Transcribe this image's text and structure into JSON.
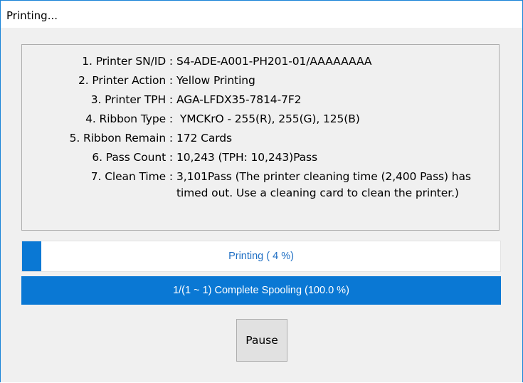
{
  "window": {
    "title": "Printing..."
  },
  "info": {
    "rows": [
      {
        "label": "1. Printer SN/ID :",
        "value": "S4-ADE-A001-PH201-01/AAAAAAAA"
      },
      {
        "label": "2. Printer Action :",
        "value": "Yellow Printing"
      },
      {
        "label": "3. Printer TPH :",
        "value": "AGA-LFDX35-7814-7F2"
      },
      {
        "label": "4. Ribbon Type :",
        "value": " YMCKrO - 255(R), 255(G), 125(B)"
      },
      {
        "label": "5. Ribbon Remain :",
        "value": "172 Cards"
      },
      {
        "label": "6. Pass Count :",
        "value": "10,243 (TPH: 10,243)Pass"
      },
      {
        "label": "7. Clean Time :",
        "value": "3,101Pass (The printer cleaning time (2,400 Pass) has timed out. Use a cleaning card to clean the printer.)"
      }
    ]
  },
  "progress": {
    "label": "Printing ( 4 %)",
    "percent": 4
  },
  "spool": {
    "label": "1/(1 ~ 1) Complete Spooling (100.0 %)",
    "percent": 100
  },
  "buttons": {
    "pause_label": "Pause"
  },
  "colors": {
    "accent": "#0a78d4",
    "window_border": "#1883d7",
    "progress_text": "#1f6fc4"
  }
}
